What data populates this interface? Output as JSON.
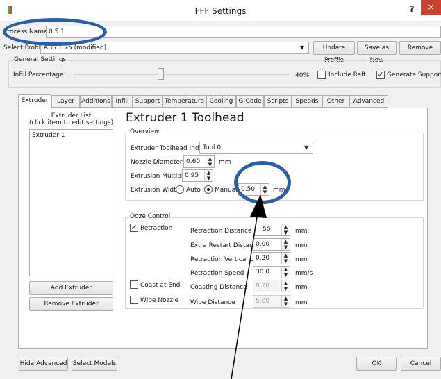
{
  "window": {
    "title": "FFF Settings",
    "help_glyph": "?",
    "close_glyph": "×"
  },
  "process": {
    "label": "Process Name:",
    "value": "0.5 1"
  },
  "profile": {
    "label": "Select Profile:",
    "selected": "ABS 1.75 (modified)",
    "update_label": "Update Profile",
    "save_new_label": "Save as New",
    "remove_label": "Remove"
  },
  "general": {
    "title": "General Settings",
    "infill_label": "Infill Percentage:",
    "infill_value": "40%",
    "infill_fraction": 0.4,
    "include_raft_label": "Include Raft",
    "include_raft_checked": false,
    "generate_support_label": "Generate Support",
    "generate_support_checked": true
  },
  "tabs": [
    {
      "label": "Extruder",
      "active": true
    },
    {
      "label": "Layer"
    },
    {
      "label": "Additions"
    },
    {
      "label": "Infill"
    },
    {
      "label": "Support"
    },
    {
      "label": "Temperature"
    },
    {
      "label": "Cooling"
    },
    {
      "label": "G-Code"
    },
    {
      "label": "Scripts"
    },
    {
      "label": "Speeds"
    },
    {
      "label": "Other"
    },
    {
      "label": "Advanced"
    }
  ],
  "extruder_list": {
    "title": "Extruder List",
    "hint": "(click item to edit settings)",
    "items": [
      "Extruder 1"
    ],
    "add_label": "Add Extruder",
    "remove_label": "Remove Extruder"
  },
  "toolhead": {
    "heading": "Extruder 1 Toolhead",
    "overview_title": "Overview",
    "index_label": "Extruder Toolhead Index",
    "index_value": "Tool 0",
    "nozzle_label": "Nozzle Diameter",
    "nozzle_value": "0.60",
    "nozzle_unit": "mm",
    "multiplier_label": "Extrusion Multiplier",
    "multiplier_value": "0.95",
    "width_label": "Extrusion Width",
    "width_auto_label": "Auto",
    "width_manual_label": "Manual",
    "width_value": "0.50",
    "width_unit": "mm"
  },
  "ooze": {
    "title": "Ooze Control",
    "retraction_label": "Retraction",
    "retraction_checked": true,
    "retract_distance_label": "Retraction Distance",
    "retract_distance_value": "50",
    "retract_distance_unit": "mm",
    "extra_restart_label": "Extra Restart Distance",
    "extra_restart_value": "0.00",
    "extra_restart_unit": "mm",
    "vertical_lift_label": "Retraction Vertical Lift",
    "vertical_lift_value": "0.20",
    "vertical_lift_unit": "mm",
    "retract_speed_label": "Retraction Speed",
    "retract_speed_value": "30.0",
    "retract_speed_unit": "mm/s",
    "coast_label": "Coast at End",
    "coast_checked": false,
    "coasting_distance_label": "Coasting Distance",
    "coasting_distance_value": "0.20",
    "coasting_distance_unit": "mm",
    "wipe_label": "Wipe Nozzle",
    "wipe_checked": false,
    "wipe_distance_label": "Wipe Distance",
    "wipe_distance_value": "5.00",
    "wipe_distance_unit": "mm"
  },
  "footer": {
    "hide_advanced_label": "Hide Advanced",
    "select_models_label": "Select Models",
    "ok_label": "OK",
    "cancel_label": "Cancel"
  },
  "colors": {
    "annotation": "#2d5da3",
    "close_button": "#c74433"
  }
}
